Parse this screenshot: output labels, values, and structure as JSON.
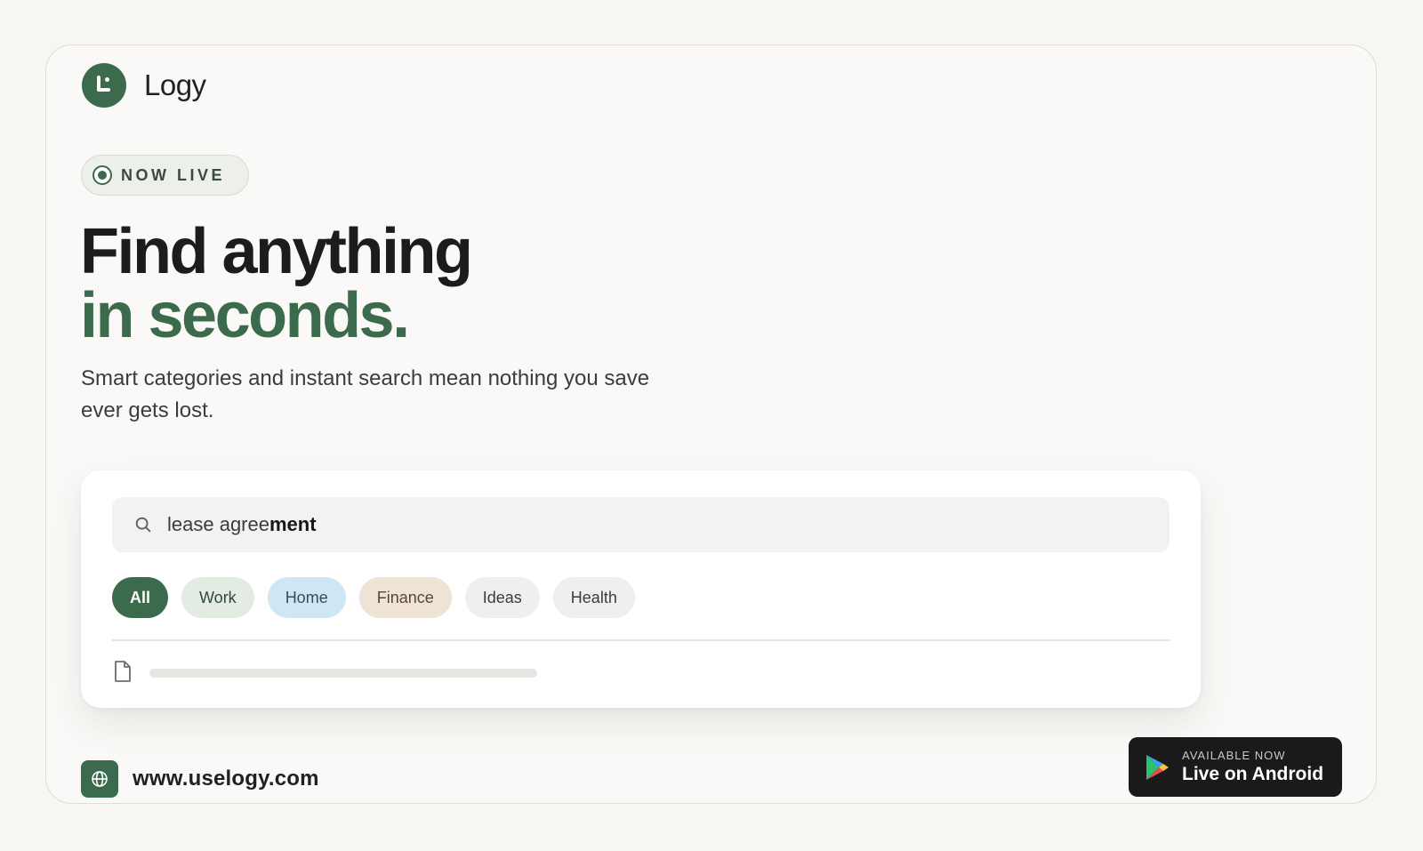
{
  "brand": {
    "name": "Logy"
  },
  "badge": {
    "label": "NOW LIVE"
  },
  "headline": {
    "line1": "Find anything",
    "line2": "in seconds."
  },
  "subtitle": "Smart categories and instant search mean nothing you save ever gets lost.",
  "search": {
    "value_normal": "lease agree",
    "value_bold": "ment",
    "icon": "search-icon"
  },
  "filters": [
    {
      "label": "All",
      "selected": true
    },
    {
      "label": "Work",
      "selected": false
    },
    {
      "label": "Home",
      "selected": false
    },
    {
      "label": "Finance",
      "selected": false
    },
    {
      "label": "Ideas",
      "selected": false
    },
    {
      "label": "Health",
      "selected": false
    }
  ],
  "result": {
    "icon": "document-icon"
  },
  "footer": {
    "url": "www.uselogy.com",
    "icon": "globe-icon"
  },
  "android_button": {
    "caption": "AVAILABLE NOW",
    "label": "Live on Android",
    "icon": "google-play-icon"
  },
  "colors": {
    "accent": "#3b6a4c",
    "background": "#f7f6f3",
    "work_chip": "#e2ece2",
    "home_chip": "#cfe7f5",
    "finance_chip": "#efe3d6",
    "neutral_chip": "#efefed",
    "android_button": "#1a1a1a"
  }
}
